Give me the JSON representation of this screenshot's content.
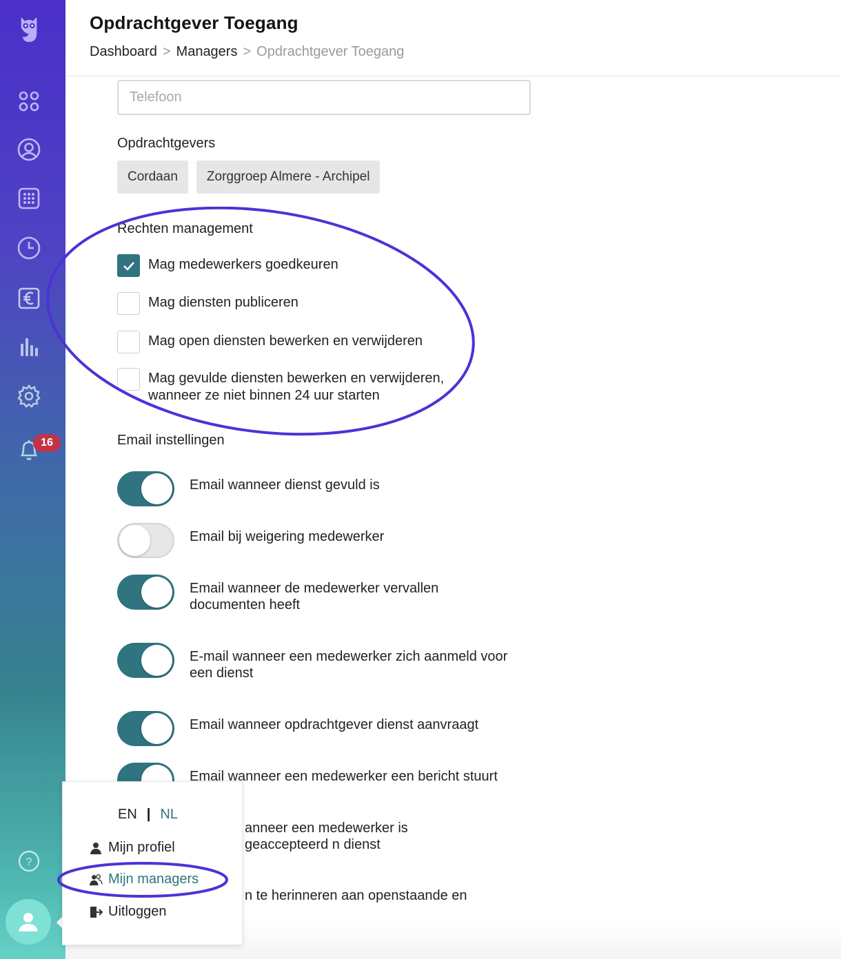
{
  "header": {
    "title": "Opdrachtgever Toegang",
    "breadcrumb": [
      {
        "label": "Dashboard"
      },
      {
        "label": "Managers"
      },
      {
        "label": "Opdrachtgever Toegang"
      }
    ],
    "separator": ">"
  },
  "form": {
    "phone_placeholder": "Telefoon",
    "clients_label": "Opdrachtgevers",
    "clients": [
      "Cordaan",
      "Zorggroep Almere - Archipel"
    ]
  },
  "rights": {
    "label": "Rechten management",
    "items": [
      {
        "label": "Mag medewerkers goedkeuren",
        "checked": true
      },
      {
        "label": "Mag diensten publiceren",
        "checked": false
      },
      {
        "label": "Mag open diensten bewerken en verwijderen",
        "checked": false
      },
      {
        "label": "Mag gevulde diensten bewerken en verwijderen, wanneer ze niet binnen 24 uur starten",
        "checked": false
      }
    ]
  },
  "email": {
    "label": "Email instellingen",
    "items": [
      {
        "label": "Email wanneer dienst gevuld is",
        "on": true
      },
      {
        "label": "Email bij weigering medewerker",
        "on": false
      },
      {
        "label": "Email wanneer de medewerker vervallen documenten heeft",
        "on": true
      },
      {
        "label": "E-mail wanneer een medewerker zich aanmeld voor een dienst",
        "on": true
      },
      {
        "label": "Email wanneer opdrachtgever dienst aanvraagt",
        "on": true
      },
      {
        "label": "Email wanneer een medewerker een bericht stuurt",
        "on": true
      },
      {
        "label": "anneer een medewerker is geaccepteerd n dienst",
        "on": true
      },
      {
        "label": "n te herinneren aan openstaande en",
        "on": true
      }
    ]
  },
  "sidebar": {
    "icons": [
      "owl-logo-icon",
      "dashboard-icon",
      "profile-icon",
      "calendar-icon",
      "clock-icon",
      "euro-icon",
      "stats-icon",
      "settings-icon",
      "bell-icon",
      "help-icon",
      "user-avatar-icon"
    ],
    "notification_count": "16"
  },
  "user_menu": {
    "lang_en": "EN",
    "lang_sep": "|",
    "lang_nl": "NL",
    "profile": "Mijn profiel",
    "managers": "Mijn managers",
    "logout": "Uitloggen"
  },
  "colors": {
    "accent": "#2f7480",
    "annotation": "#4b33d6",
    "badge": "#c0334a"
  }
}
